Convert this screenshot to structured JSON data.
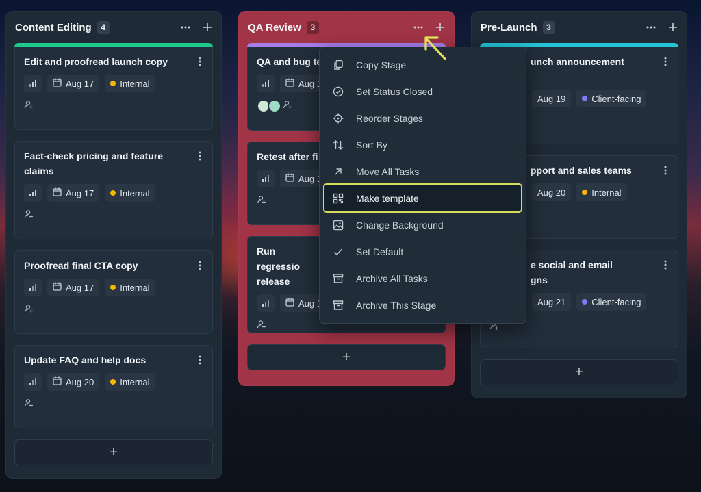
{
  "columns": [
    {
      "title": "Content Editing",
      "count": "4",
      "accent": "#1ec98a",
      "cards": [
        {
          "title": "Edit and proofread launch copy",
          "date": "Aug 17",
          "tag": "Internal",
          "tag_color": "#f5b700"
        },
        {
          "title": "Fact-check pricing and feature claims",
          "date": "Aug 17",
          "tag": "Internal",
          "tag_color": "#f5b700"
        },
        {
          "title": "Proofread final CTA copy",
          "date": "Aug 17",
          "tag": "Internal",
          "tag_color": "#f5b700"
        },
        {
          "title": "Update FAQ and help docs",
          "date": "Aug 20",
          "tag": "Internal",
          "tag_color": "#f5b700"
        }
      ],
      "add_label": "+"
    },
    {
      "title": "QA Review",
      "count": "3",
      "accent": "#a77ee8",
      "cards": [
        {
          "title": "QA and bug te",
          "date": "Aug 1"
        },
        {
          "title": "Retest after fi",
          "date": "Aug 1"
        },
        {
          "title": "Run regressio release",
          "date": "Aug 1"
        }
      ],
      "add_label": "+"
    },
    {
      "title": "Pre-Launch",
      "count": "3",
      "accent": "#25c4d6",
      "cards": [
        {
          "title": "unch announcement",
          "date": "Aug 19",
          "tag": "Client-facing",
          "tag_color": "#7d7df5"
        },
        {
          "title": "pport and sales teams",
          "date": "Aug 20",
          "tag": "Internal",
          "tag_color": "#f5b700"
        },
        {
          "title": "e social and email gns",
          "date": "Aug 21",
          "tag": "Client-facing",
          "tag_color": "#7d7df5"
        }
      ],
      "add_label": "+"
    }
  ],
  "stage_menu": {
    "items": [
      {
        "label": "Copy Stage",
        "icon": "copy-icon"
      },
      {
        "label": "Set Status Closed",
        "icon": "check-circle-icon"
      },
      {
        "label": "Reorder Stages",
        "icon": "crosshair-icon"
      },
      {
        "label": "Sort By",
        "icon": "sort-icon"
      },
      {
        "label": "Move All Tasks",
        "icon": "arrow-up-right-icon"
      },
      {
        "label": "Make template",
        "icon": "template-grid-icon",
        "highlighted": true
      },
      {
        "label": "Change Background",
        "icon": "image-icon"
      },
      {
        "label": "Set Default",
        "icon": "check-icon"
      },
      {
        "label": "Archive All Tasks",
        "icon": "archive-icon"
      },
      {
        "label": "Archive This Stage",
        "icon": "archive-icon"
      }
    ],
    "highlight_color": "#d6dc5b"
  }
}
